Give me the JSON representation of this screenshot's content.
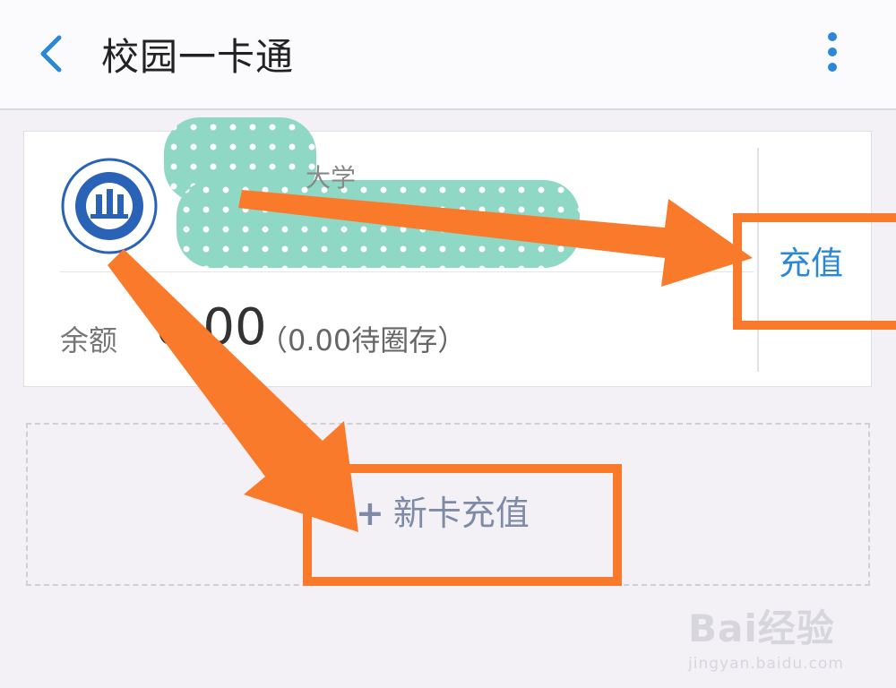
{
  "header": {
    "title": "校园一卡通",
    "back_icon": "chevron-left-icon",
    "more_icon": "more-vertical-icon",
    "accent_color": "#2a88d6"
  },
  "card": {
    "school_name_visible": "大学",
    "recharge_label": "充值",
    "balance_label": "余额",
    "balance_amount": "0.00",
    "pending_text": "（0.00待圈存）",
    "logo_icon": "university-logo-icon"
  },
  "new_card": {
    "plus": "+",
    "label": "新卡充值"
  },
  "annotations": {
    "color": "#f97a2a"
  },
  "watermark": {
    "line1": "Bai经验",
    "line2": "jingyan.baidu.com"
  }
}
